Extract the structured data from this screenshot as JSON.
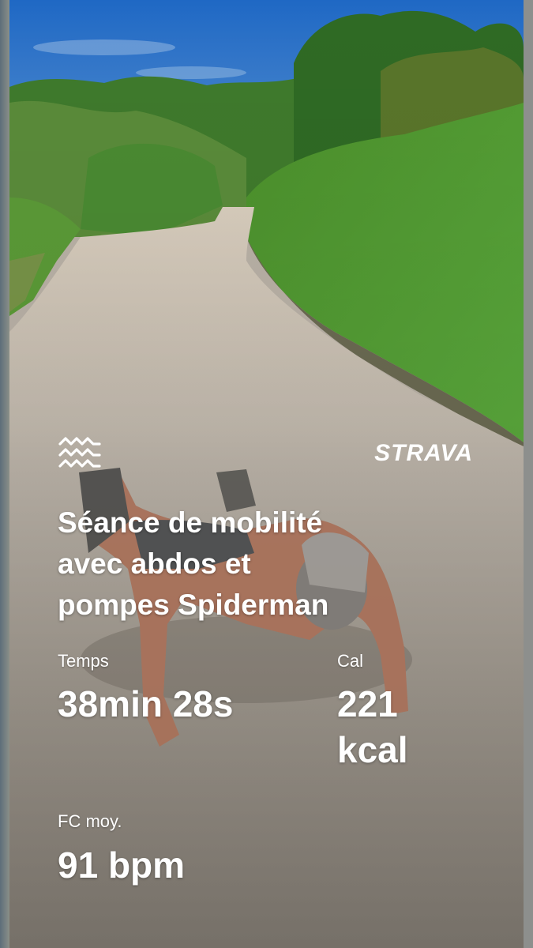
{
  "brand": {
    "logo_text": "STRAVA",
    "icon": "strava-waves-icon"
  },
  "activity": {
    "title_line1": "Séance de mobilité",
    "title_line2": "avec abdos et",
    "title_line3": "pompes Spiderman"
  },
  "stats": {
    "time": {
      "label": "Temps",
      "value": "38min 28s"
    },
    "calories": {
      "label": "Cal",
      "value_line1": "221",
      "value_line2": "kcal"
    },
    "heart_rate": {
      "label": "FC moy.",
      "value": "91 bpm"
    }
  },
  "colors": {
    "text": "#ffffff",
    "sky": "#2a74c9",
    "grass": "#4f9a35",
    "path": "#b7aea3"
  }
}
